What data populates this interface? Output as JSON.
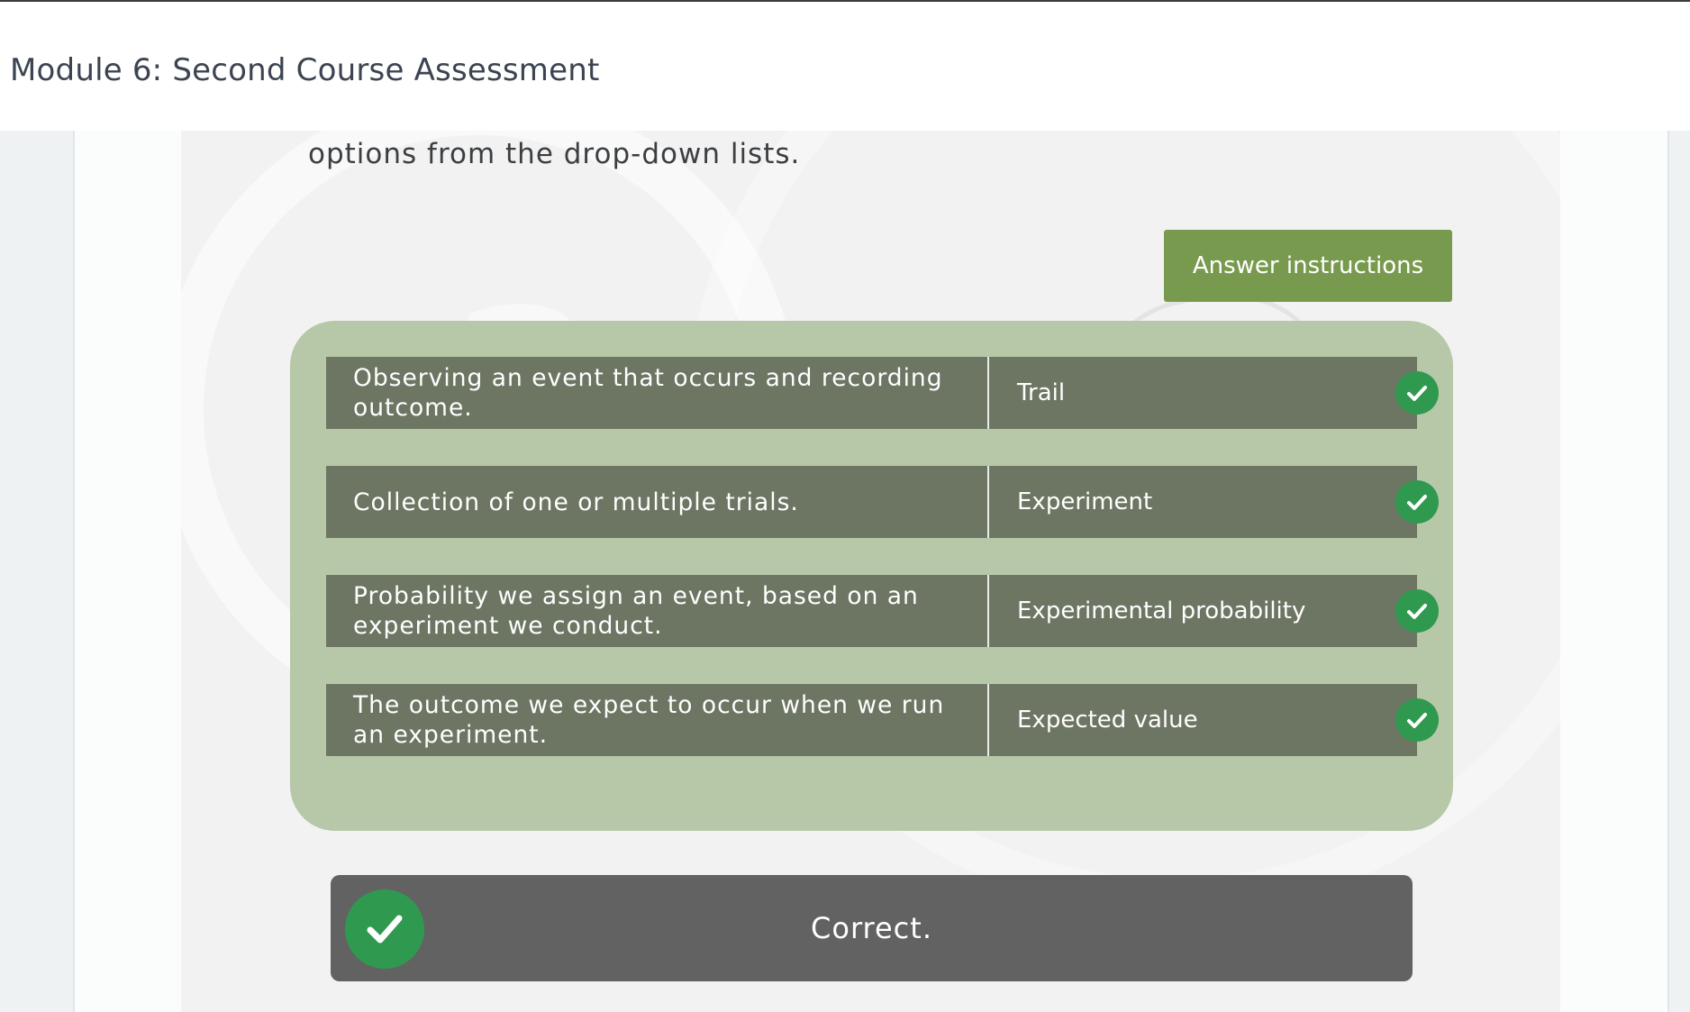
{
  "header": {
    "title": "Module 6: Second Course Assessment"
  },
  "slide": {
    "instructions_tail": "options from the drop-down lists.",
    "answer_button_label": "Answer instructions",
    "rows": [
      {
        "term": "Observing an event that occurs and recording outcome.",
        "answer": "Trail",
        "status": "correct"
      },
      {
        "term": "Collection of one or multiple trials.",
        "answer": "Experiment",
        "status": "correct"
      },
      {
        "term": "Probability we assign an event, based on an experiment we conduct.",
        "answer": "Experimental probability",
        "status": "correct"
      },
      {
        "term": "The outcome we expect to occur when we run an experiment.",
        "answer": "Expected value",
        "status": "correct"
      }
    ],
    "feedback": {
      "text": "Correct.",
      "icon": "check-circle-icon"
    }
  },
  "colors": {
    "accent_button": "#789a4e",
    "match_container": "#b6c8a8",
    "row_background": "#6c7662",
    "correct_green": "#2f9a4f",
    "feedback_background": "#626262"
  }
}
